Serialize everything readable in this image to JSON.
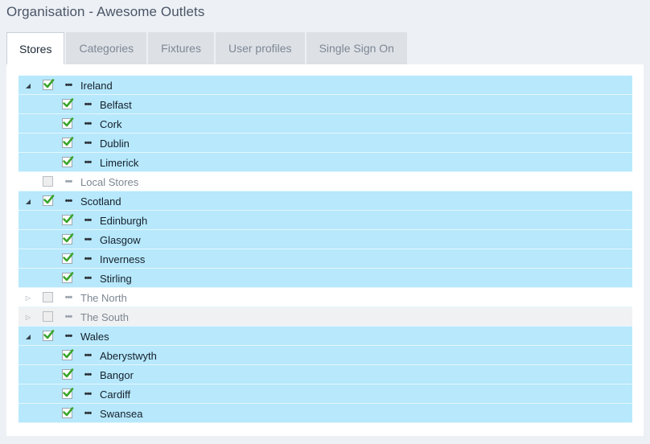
{
  "page": {
    "title": "Organisation - Awesome Outlets"
  },
  "tabs": [
    {
      "label": "Stores",
      "active": true
    },
    {
      "label": "Categories",
      "active": false
    },
    {
      "label": "Fixtures",
      "active": false
    },
    {
      "label": "User profiles",
      "active": false
    },
    {
      "label": "Single Sign On",
      "active": false
    }
  ],
  "tree": {
    "rows": [
      {
        "label": "Ireland",
        "level": 0,
        "checked": true,
        "expander": "expanded"
      },
      {
        "label": "Belfast",
        "level": 1,
        "checked": true
      },
      {
        "label": "Cork",
        "level": 1,
        "checked": true
      },
      {
        "label": "Dublin",
        "level": 1,
        "checked": true
      },
      {
        "label": "Limerick",
        "level": 1,
        "checked": true
      },
      {
        "label": "Local Stores",
        "level": 0,
        "checked": false,
        "expander": "none"
      },
      {
        "label": "Scotland",
        "level": 0,
        "checked": true,
        "expander": "expanded"
      },
      {
        "label": "Edinburgh",
        "level": 1,
        "checked": true
      },
      {
        "label": "Glasgow",
        "level": 1,
        "checked": true
      },
      {
        "label": "Inverness",
        "level": 1,
        "checked": true
      },
      {
        "label": "Stirling",
        "level": 1,
        "checked": true
      },
      {
        "label": "The North",
        "level": 0,
        "checked": false,
        "expander": "collapsed"
      },
      {
        "label": "The South",
        "level": 0,
        "checked": false,
        "expander": "collapsed",
        "alt": true
      },
      {
        "label": "Wales",
        "level": 0,
        "checked": true,
        "expander": "expanded"
      },
      {
        "label": "Aberystwyth",
        "level": 1,
        "checked": true
      },
      {
        "label": "Bangor",
        "level": 1,
        "checked": true
      },
      {
        "label": "Cardiff",
        "level": 1,
        "checked": true
      },
      {
        "label": "Swansea",
        "level": 1,
        "checked": true
      }
    ]
  },
  "icons": {
    "expanded": "triangle-down-right-icon",
    "collapsed": "triangle-right-icon",
    "checked": "green-checkmark-icon",
    "node": "ellipsis-icon"
  },
  "colors": {
    "checked_row": "#b7e8fc",
    "check_green": "#3aa52b"
  }
}
